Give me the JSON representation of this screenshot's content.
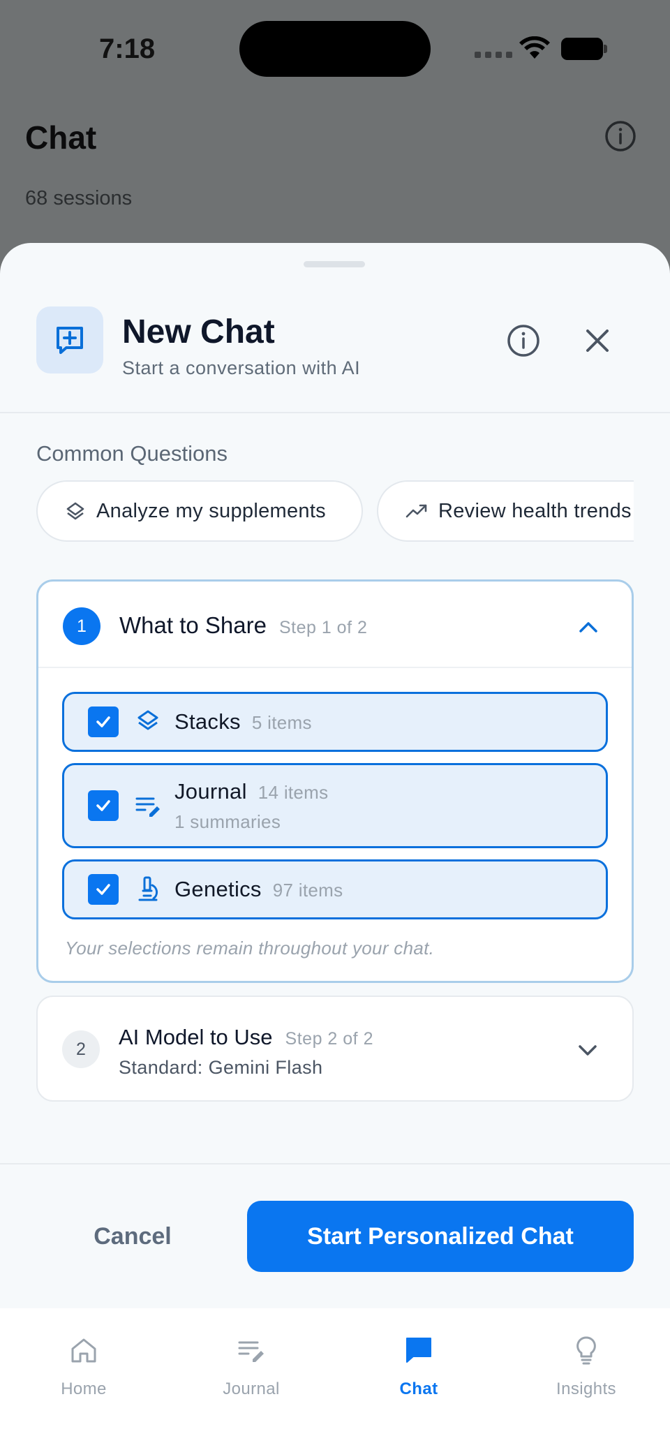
{
  "colors": {
    "accent": "#0a76f0",
    "selected_bg": "#e6f0fb",
    "muted_text": "#9aa3ad",
    "scrim": "#6f7273"
  },
  "status_bar": {
    "time": "7:18"
  },
  "background_screen": {
    "title": "Chat",
    "subtitle": "68 sessions",
    "info_icon": "info-icon"
  },
  "sheet": {
    "title": "New Chat",
    "subtitle": "Start a conversation with AI",
    "header_icon": "chat-plus-icon",
    "common_questions": {
      "label": "Common Questions",
      "chips": [
        {
          "label": "Analyze my supplements",
          "icon": "layers-icon"
        },
        {
          "label": "Review health trends",
          "icon": "trending-up-icon"
        }
      ]
    },
    "step1": {
      "number": "1",
      "title": "What to Share",
      "meta": "Step 1 of 2",
      "expanded": true,
      "items": [
        {
          "name": "Stacks",
          "count": "5 items",
          "icon": "layers-icon",
          "checked": true
        },
        {
          "name": "Journal",
          "count": "14 items",
          "sub": "1 summaries",
          "icon": "edit-notes-icon",
          "checked": true
        },
        {
          "name": "Genetics",
          "count": "97 items",
          "icon": "microscope-icon",
          "checked": true
        }
      ],
      "note": "Your selections remain throughout your chat."
    },
    "step2": {
      "number": "2",
      "title": "AI Model to Use",
      "meta": "Step 2 of 2",
      "subtitle": "Standard: Gemini Flash",
      "expanded": false
    },
    "cancel_label": "Cancel",
    "start_label": "Start Personalized Chat"
  },
  "tabbar": {
    "tabs": [
      {
        "label": "Home",
        "icon": "home-icon",
        "active": false
      },
      {
        "label": "Journal",
        "icon": "journal-icon",
        "active": false
      },
      {
        "label": "Chat",
        "icon": "chat-icon",
        "active": true
      },
      {
        "label": "Insights",
        "icon": "lightbulb-icon",
        "active": false
      }
    ]
  }
}
